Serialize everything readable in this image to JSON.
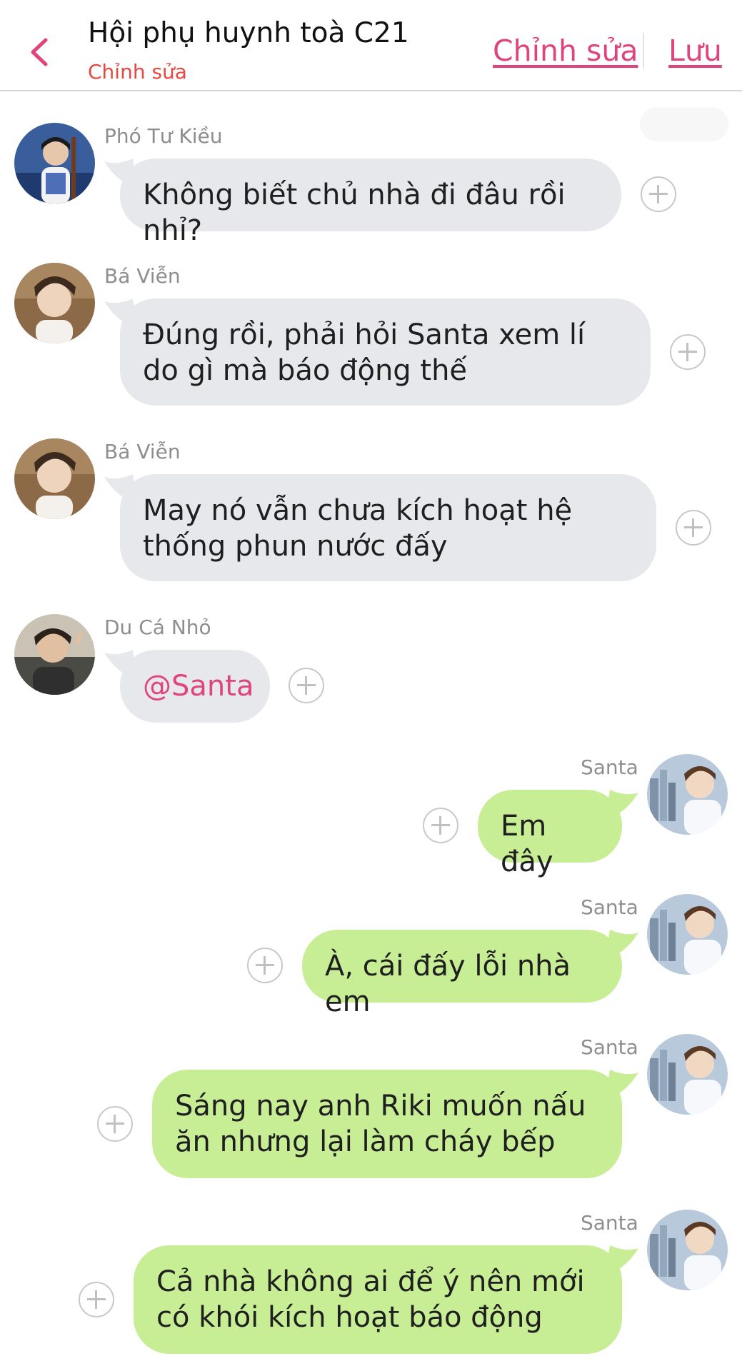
{
  "header": {
    "title": "Hội phụ huynh toà C21",
    "subtitle": "Chỉnh sửa",
    "edit_label": "Chỉnh sửa",
    "save_label": "Lưu",
    "accent_color": "#e0447d",
    "subtitle_color": "#e8483f"
  },
  "messages": [
    {
      "sender": "Phó Tư Kiều",
      "text": "Không biết chủ nhà đi đâu rồi nhỉ?",
      "direction": "incoming"
    },
    {
      "sender": "Bá Viễn",
      "text": "Đúng rồi, phải hỏi Santa xem lí do gì mà báo động thế",
      "direction": "incoming"
    },
    {
      "sender": "Bá Viễn",
      "text": "May nó vẫn chưa kích hoạt hệ thống phun nước đấy",
      "direction": "incoming"
    },
    {
      "sender": "Du Cá Nhỏ",
      "text": "@Santa",
      "direction": "incoming"
    },
    {
      "sender": "Santa",
      "text": "Em đây",
      "direction": "outgoing"
    },
    {
      "sender": "Santa",
      "text": "À, cái đấy lỗi nhà em",
      "direction": "outgoing"
    },
    {
      "sender": "Santa",
      "text": "Sáng nay anh Riki muốn nấu ăn nhưng lại làm cháy bếp",
      "direction": "outgoing"
    },
    {
      "sender": "Santa",
      "text": "Cả nhà không ai để ý nên mới có khói kích hoạt báo động",
      "direction": "outgoing"
    }
  ],
  "colors": {
    "incoming_bubble": "#e6e8eb",
    "outgoing_bubble": "#c8ee95",
    "sender_name": "#8e8e8e"
  },
  "icons": {
    "back": "chevron-left-icon",
    "reaction": "plus-circle-icon"
  }
}
